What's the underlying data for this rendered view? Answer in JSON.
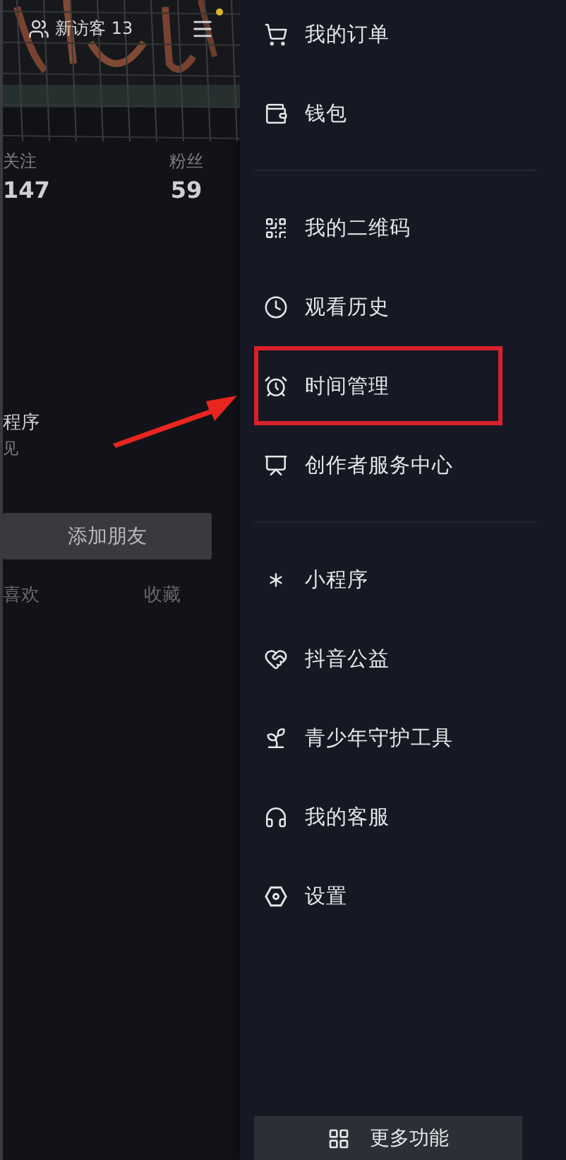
{
  "profile": {
    "visitors": "新访客 13",
    "notification_dot": true,
    "stats": [
      {
        "label": "关注",
        "value": "147"
      },
      {
        "label": "粉丝",
        "value": "59"
      }
    ],
    "mini_program": {
      "title": "程序",
      "subtitle": "见"
    },
    "add_friend_button": "添加朋友",
    "tab_labels": [
      "喜欢",
      "收藏"
    ]
  },
  "drawer": {
    "sections": [
      [
        {
          "label": "我的订单",
          "highlighted": false
        },
        {
          "label": "钱包",
          "highlighted": false
        }
      ],
      [
        {
          "label": "我的二维码",
          "highlighted": false
        },
        {
          "label": "观看历史",
          "highlighted": false
        },
        {
          "label": "时间管理",
          "highlighted": true
        },
        {
          "label": "创作者服务中心",
          "highlighted": false
        }
      ],
      [
        {
          "label": "小程序",
          "highlighted": false
        },
        {
          "label": "抖音公益",
          "highlighted": false
        },
        {
          "label": "青少年守护工具",
          "highlighted": false
        },
        {
          "label": "我的客服",
          "highlighted": false
        },
        {
          "label": "设置",
          "highlighted": false
        }
      ]
    ],
    "more_button": "更多功能"
  }
}
